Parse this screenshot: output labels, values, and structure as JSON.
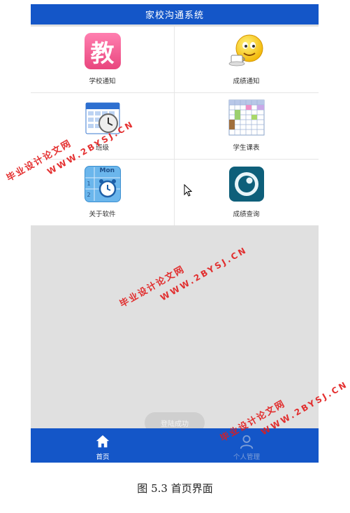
{
  "app": {
    "title": "家校沟通系统"
  },
  "grid": {
    "items": [
      {
        "label": "学校通知",
        "icon": "jiao-character-icon",
        "glyph": "教"
      },
      {
        "label": "成绩通知",
        "icon": "smiley-coffee-icon"
      },
      {
        "label": "班级",
        "icon": "calendar-clock-icon"
      },
      {
        "label": "学生课表",
        "icon": "timetable-grid-icon"
      },
      {
        "label": "关于软件",
        "icon": "alarm-calendar-icon",
        "day": "Mon",
        "nums": [
          "1",
          "2"
        ]
      },
      {
        "label": "成绩查询",
        "icon": "eye-lens-icon"
      }
    ]
  },
  "toast": {
    "text": "登陆成功"
  },
  "nav": {
    "items": [
      {
        "label": "首页",
        "icon": "home-icon",
        "active": true
      },
      {
        "label": "个人管理",
        "icon": "person-icon",
        "active": false
      }
    ]
  },
  "caption": "图 5.3 首页界面",
  "watermark": {
    "cn": "毕业设计论文网",
    "url": "WWW.2BYSJ.CN"
  },
  "colors": {
    "primary": "#1456c8",
    "background": "#e0e0e0",
    "watermark": "#e21b1b"
  }
}
